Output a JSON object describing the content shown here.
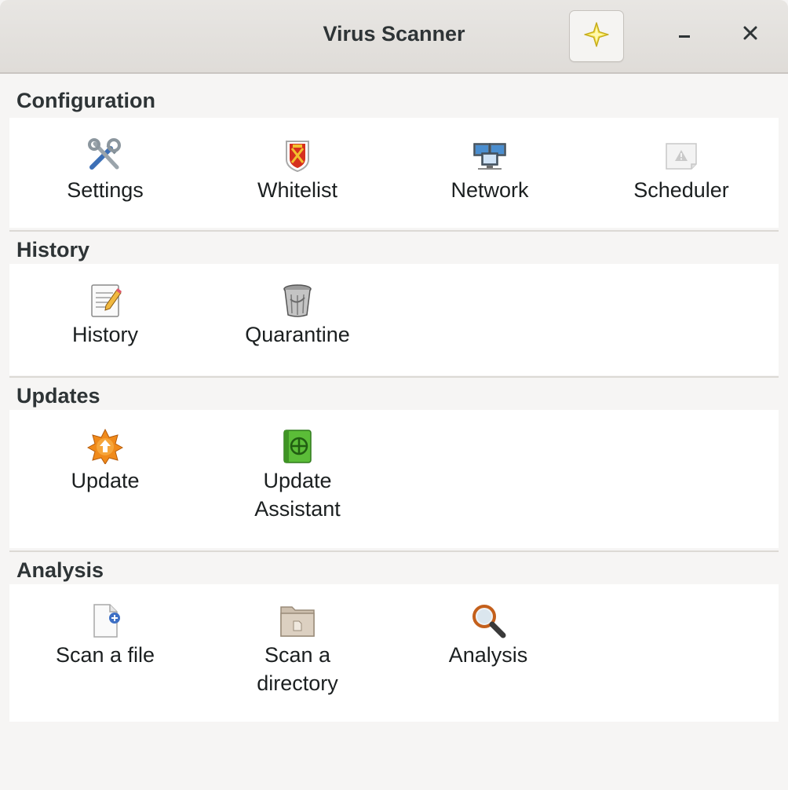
{
  "window": {
    "title": "Virus Scanner",
    "star_icon": "star-icon",
    "minimize_icon": "minimize-icon",
    "close_icon": "close-icon"
  },
  "sections": [
    {
      "title": "Configuration",
      "items": [
        {
          "label": "Settings",
          "icon": "tools-icon"
        },
        {
          "label": "Whitelist",
          "icon": "shield-icon"
        },
        {
          "label": "Network",
          "icon": "network-icon"
        },
        {
          "label": "Scheduler",
          "icon": "scheduler-warning-icon"
        }
      ]
    },
    {
      "title": "History",
      "items": [
        {
          "label": "History",
          "icon": "document-edit-icon"
        },
        {
          "label": "Quarantine",
          "icon": "trash-can-icon"
        }
      ]
    },
    {
      "title": "Updates",
      "items": [
        {
          "label": "Update",
          "icon": "update-star-icon"
        },
        {
          "label": "Update\nAssistant",
          "icon": "green-book-icon"
        }
      ]
    },
    {
      "title": "Analysis",
      "items": [
        {
          "label": "Scan a file",
          "icon": "file-add-icon"
        },
        {
          "label": "Scan a\ndirectory",
          "icon": "folder-icon"
        },
        {
          "label": "Analysis",
          "icon": "magnifier-icon"
        }
      ]
    }
  ],
  "colors": {
    "background": "#f6f5f4",
    "panel": "#ffffff",
    "titlebar": "#e3e0dc"
  }
}
